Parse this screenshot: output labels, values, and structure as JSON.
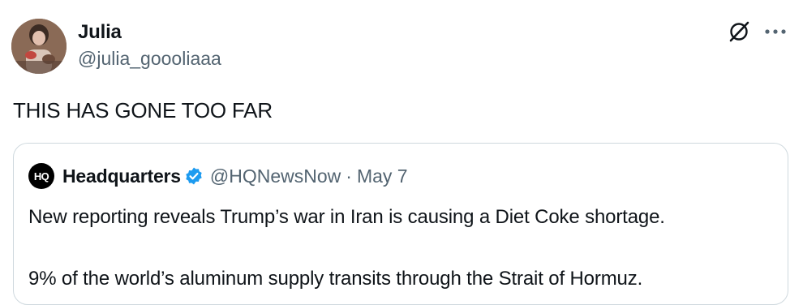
{
  "post": {
    "author": {
      "display_name": "Julia",
      "handle": "@julia_goooliaaa"
    },
    "text": "THIS HAS GONE TOO FAR",
    "actions": {
      "grok_icon": "grok-slash-icon",
      "more_icon": "more-horizontal-icon"
    }
  },
  "quote": {
    "logo_text": "HQ",
    "author_name": "Headquarters",
    "verified": true,
    "handle": "@HQNewsNow",
    "separator": "·",
    "date": "May 7",
    "paragraphs": [
      "New reporting reveals Trump’s war in Iran is causing a Diet Coke shortage.",
      "9% of the world’s aluminum supply transits through the Strait of Hormuz."
    ]
  },
  "colors": {
    "text": "#0f1419",
    "secondary": "#536471",
    "border": "#cfd9de",
    "verified": "#1d9bf0"
  }
}
